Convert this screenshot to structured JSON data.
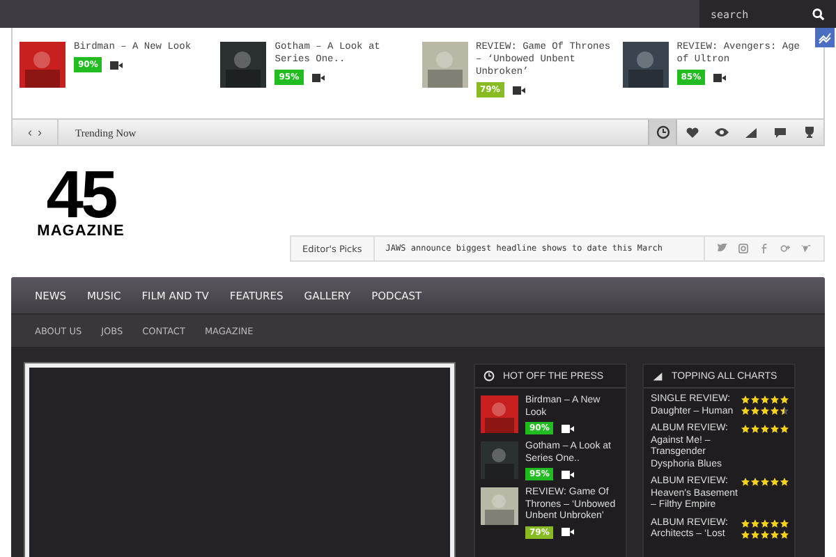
{
  "search": {
    "placeholder": "search"
  },
  "trending": {
    "items": [
      {
        "title": "Birdman – A New Look",
        "score": "90%",
        "color": "#22bb22"
      },
      {
        "title": "Gotham – A Look at Series One..",
        "score": "95%",
        "color": "#22bb22"
      },
      {
        "title": "REVIEW: Game Of Thrones – ‘Unbowed Unbent Unbroken’",
        "score": "79%",
        "color": "#88bb22"
      },
      {
        "title": "REVIEW: Avengers: Age of Ultron",
        "score": "85%",
        "color": "#22bb22"
      }
    ],
    "prev": "‹",
    "next": "›",
    "label": "Trending Now",
    "tabs": [
      {
        "kind": "clock",
        "selected": true
      },
      {
        "kind": "heart",
        "selected": false
      },
      {
        "kind": "eye",
        "selected": false
      },
      {
        "kind": "signal",
        "selected": false
      },
      {
        "kind": "chat",
        "selected": false
      },
      {
        "kind": "trophy",
        "selected": false
      }
    ]
  },
  "logo": {
    "number": "45",
    "name": "MAGAZINE"
  },
  "editors_picks": {
    "label": "Editor's Picks",
    "headline": "JAWS announce biggest headline shows to date this March",
    "social": [
      {
        "kind": "twitter"
      },
      {
        "kind": "instagram"
      },
      {
        "kind": "facebook"
      },
      {
        "kind": "googleplus"
      },
      {
        "kind": "vimeo"
      }
    ]
  },
  "nav": {
    "main": [
      "NEWS",
      "MUSIC",
      "FILM AND TV",
      "FEATURES",
      "GALLERY",
      "PODCAST"
    ],
    "sub": [
      "ABOUT US",
      "JOBS",
      "CONTACT",
      "MAGAZINE"
    ]
  },
  "hot": {
    "title": "HOT OFF THE PRESS",
    "items": [
      {
        "title": "Birdman – A New Look",
        "score": "90%",
        "color": "#22bb22"
      },
      {
        "title": "Gotham – A Look at Series One..",
        "score": "95%",
        "color": "#22bb22"
      },
      {
        "title": "REVIEW: Game Of Thrones – ‘Unbowed Unbent Unbroken’",
        "score": "79%",
        "color": "#88bb22"
      }
    ]
  },
  "charts": {
    "title": "TOPPING ALL CHARTS",
    "items": [
      {
        "kicker": "SINGLE REVIEW:",
        "title": "Daughter – Human",
        "ratings": [
          {
            "stars": 5
          },
          {
            "stars": 4.5
          }
        ]
      },
      {
        "kicker": "ALBUM REVIEW:",
        "title": "Against Me! – Transgender Dysphoria Blues",
        "ratings": [
          {
            "stars": 5
          }
        ]
      },
      {
        "kicker": "ALBUM REVIEW:",
        "title": "Heaven's Basement – Filthy Empire",
        "ratings": [
          {
            "stars": 5
          }
        ]
      },
      {
        "kicker": "ALBUM REVIEW:",
        "title": "Architects – ‘Lost",
        "ratings": [
          {
            "stars": 5
          },
          {
            "stars": 5
          }
        ]
      }
    ]
  }
}
